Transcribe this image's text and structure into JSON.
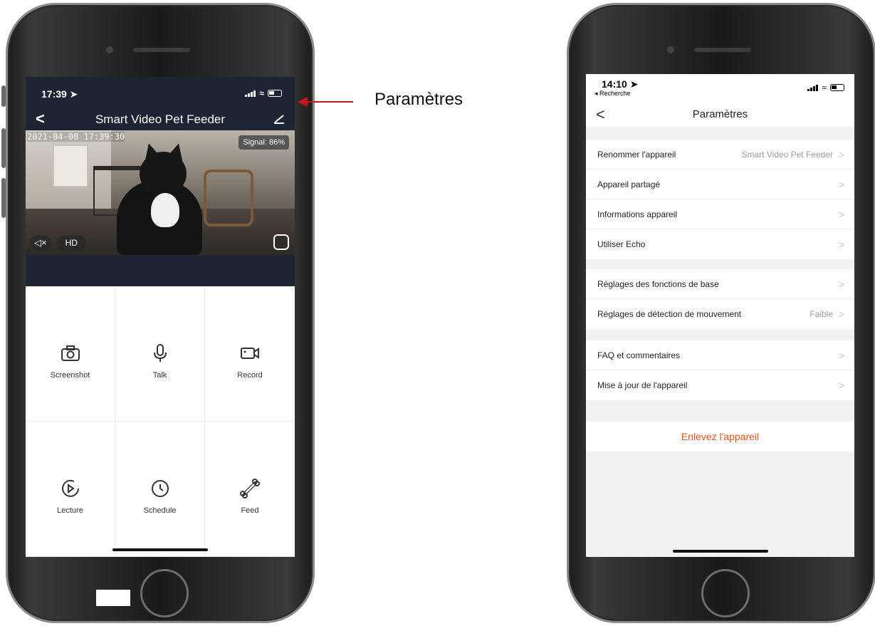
{
  "annotation": {
    "label": "Paramètres"
  },
  "left": {
    "status": {
      "time": "17:39 ➤"
    },
    "nav": {
      "back": "<",
      "title": "Smart Video Pet Feeder"
    },
    "video": {
      "timestamp": "2021-04-08 17:39:30",
      "signal": "Signal: 86%",
      "mute": "◁×",
      "quality": "HD"
    },
    "actions": [
      {
        "label": "Screenshot",
        "icon": "camera-icon"
      },
      {
        "label": "Talk",
        "icon": "microphone-icon"
      },
      {
        "label": "Record",
        "icon": "video-camera-icon"
      },
      {
        "label": "Lecture",
        "icon": "playback-icon"
      },
      {
        "label": "Schedule",
        "icon": "clock-icon"
      },
      {
        "label": "Feed",
        "icon": "bone-icon"
      }
    ]
  },
  "right": {
    "status": {
      "time": "14:10 ➤",
      "back_app": "◂ Recherche"
    },
    "nav": {
      "back": "<",
      "title": "Paramètres"
    },
    "group1": [
      {
        "label": "Renommer l'appareil",
        "value": "Smart Video Pet Feeder"
      },
      {
        "label": "Appareil partagé",
        "value": ""
      },
      {
        "label": "Informations appareil",
        "value": ""
      },
      {
        "label": "Utiliser Echo",
        "value": ""
      }
    ],
    "group2": [
      {
        "label": "Réglages des fonctions de base",
        "value": ""
      },
      {
        "label": "Réglages de détection de mouvement",
        "value": "Faible"
      }
    ],
    "group3": [
      {
        "label": "FAQ et commentaires",
        "value": ""
      },
      {
        "label": "Mise à jour de l'appareil",
        "value": ""
      }
    ],
    "remove_label": "Enlevez l'appareil",
    "chevron": ">",
    "accent_color": "#e8501f"
  }
}
